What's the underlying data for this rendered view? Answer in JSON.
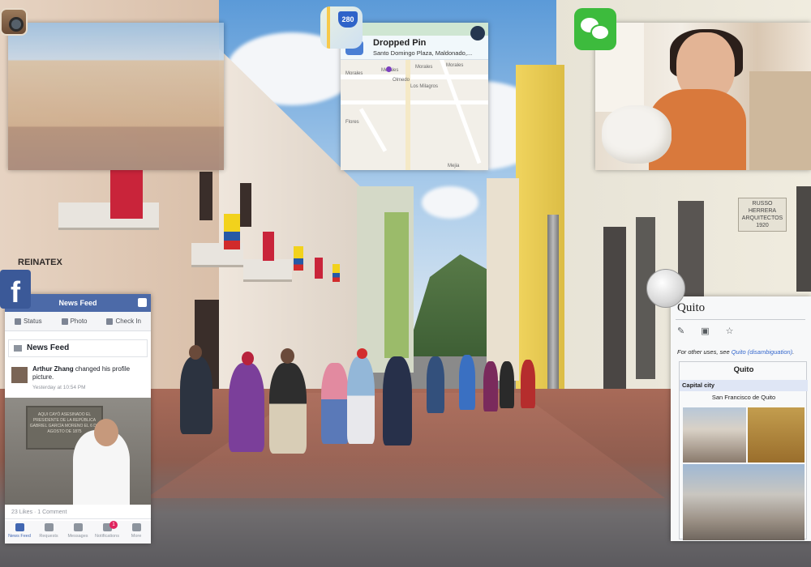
{
  "maps": {
    "shield": "280",
    "title": "Dropped Pin",
    "subtitle": "Santo Domingo Plaza, Maldonado,...",
    "labels": [
      "Morales",
      "Morales",
      "Morales",
      "Morales",
      "Olmedo",
      "Los Milagros",
      "Flores",
      "Mejia"
    ]
  },
  "facebook": {
    "icon": "f",
    "title": "News Feed",
    "actions": {
      "status": "Status",
      "photo": "Photo",
      "checkin": "Check In"
    },
    "feed_header": "News Feed",
    "post_author": "Arthur Zhang",
    "post_text": " changed his profile picture.",
    "post_time": "Yesterday at 10:54 PM",
    "plaque": "AQUI CAYÓ ASESINADO EL PRESIDENTE DE LA REPÚBLICA GABRIEL GARCÍA MORENO EL 6 DE AGOSTO DE 1875",
    "stats": "23 Likes · 1 Comment",
    "tabs": [
      "News Feed",
      "Requests",
      "Messages",
      "Notifications",
      "More"
    ],
    "notifications_badge": "1"
  },
  "wikipedia": {
    "title": "Quito",
    "note_prefix": "For other uses, see ",
    "note_link": "Quito (disambiguation)",
    "note_suffix": ".",
    "infobox_title": "Quito",
    "infobox_head": "Capital city",
    "infobox_value": "San Francisco de Quito"
  },
  "signs": {
    "store": "REINATEX",
    "arch": "RUSSO HERRERA ARQUITECTOS",
    "year": "1920"
  },
  "colors": {
    "facebook_blue": "#3b5998",
    "wechat_green": "#3dbb3d",
    "wiki_link": "#3366cc"
  }
}
